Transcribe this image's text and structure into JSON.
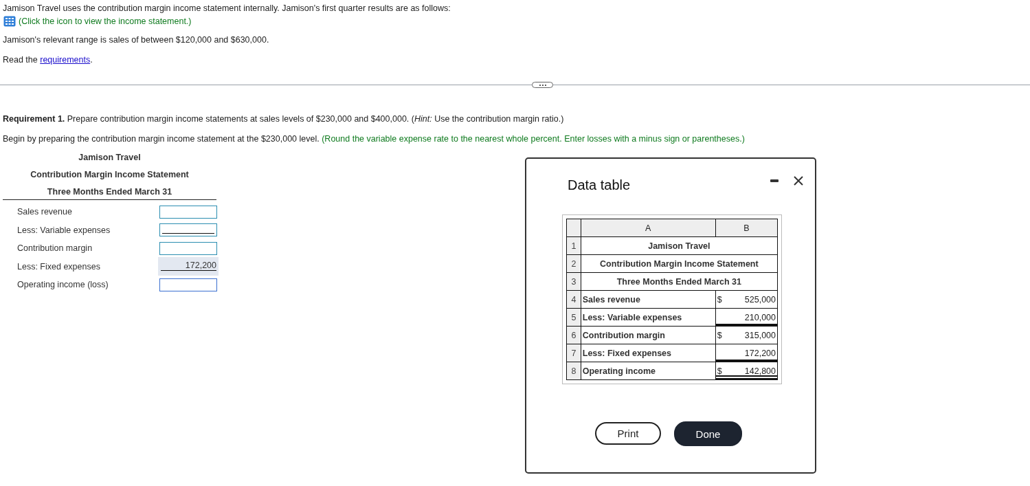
{
  "intro": {
    "text": "Jamison Travel uses the contribution margin income statement internally. Jamison's first quarter results are as follows:",
    "statement_link": "(Click the icon to view the income statement.)",
    "range": "Jamison's relevant range is sales of between $120,000 and $630,000.",
    "read_prefix": "Read the",
    "requirements_link": "requirements",
    "read_suffix": "."
  },
  "requirement": {
    "text": "**Requirement 1.** Prepare contribution margin income statements at sales levels of $230,000 and $400,000. (*Hint:* Use the contribution margin ratio.)",
    "begin": "Begin by preparing the contribution margin income statement at the $230,000 level.",
    "hint": "(Round the variable expense rate to the nearest whole percent. Enter losses with a minus sign or parentheses.)"
  },
  "worksheet": {
    "titles": [
      "Jamison Travel",
      "Contribution Margin Income Statement",
      "Three Months Ended March 31"
    ],
    "rows": [
      {
        "label": "Sales revenue",
        "kind": "input",
        "underline": false
      },
      {
        "label": "Less: Variable expenses",
        "kind": "input",
        "underline": true
      },
      {
        "label": "Contribution margin",
        "kind": "input",
        "underline": false
      },
      {
        "label": "Less: Fixed expenses",
        "kind": "given",
        "value": "172,200",
        "underline": true
      },
      {
        "label": "Operating income (loss)",
        "kind": "input",
        "underline": false
      }
    ]
  },
  "dialog": {
    "title": "Data table",
    "columns": [
      "A",
      "B"
    ],
    "header_rows": [
      {
        "num": "1",
        "text": "Jamison Travel"
      },
      {
        "num": "2",
        "text": "Contribution Margin Income Statement"
      },
      {
        "num": "3",
        "text": "Three Months Ended March 31"
      }
    ],
    "rows": [
      {
        "num": "4",
        "label": "Sales revenue",
        "currency": "$",
        "value": "525,000",
        "underline": false,
        "double": false
      },
      {
        "num": "5",
        "label": "Less: Variable expenses",
        "value": "210,000",
        "underline": true,
        "double": false
      },
      {
        "num": "6",
        "label": "Contribution margin",
        "currency": "$",
        "value": "315,000",
        "underline": false,
        "double": false
      },
      {
        "num": "7",
        "label": "Less: Fixed expenses",
        "value": "172,200",
        "underline": true,
        "double": false
      },
      {
        "num": "8",
        "label": "Operating income",
        "currency": "$",
        "value": "142,800",
        "underline": true,
        "double": true
      }
    ],
    "buttons": [
      {
        "label": "Print",
        "kind": "secondary"
      },
      {
        "label": "Done",
        "kind": "primary"
      }
    ]
  }
}
